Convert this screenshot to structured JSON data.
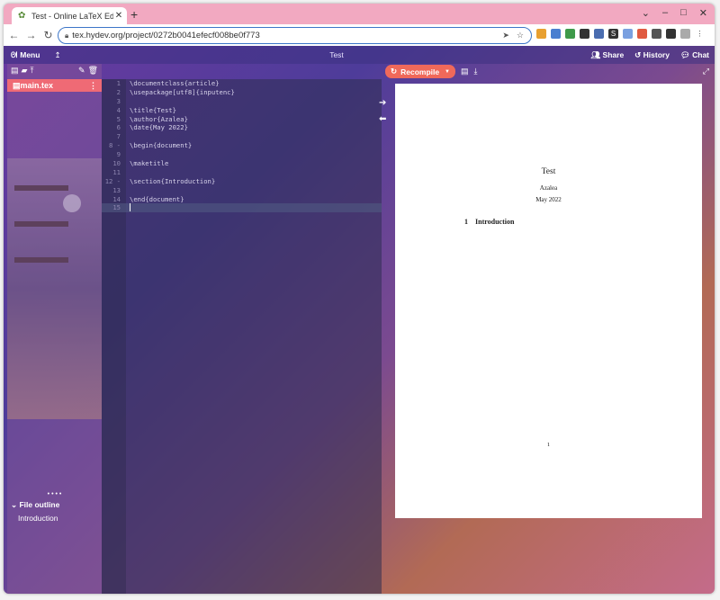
{
  "browser": {
    "tab_title": "Test - Online LaTeX Editor ov...",
    "new_tab": "+",
    "url": "tex.hydev.org/project/0272b0041efecf008be0f773",
    "window_controls": [
      "⌄",
      "–",
      "□",
      "✕"
    ]
  },
  "app": {
    "menu_label": "Menu",
    "project_title": "Test",
    "share_label": "Share",
    "history_label": "History",
    "chat_label": "Chat"
  },
  "filetree": {
    "file_name": "main.tex",
    "outline_header": "File outline",
    "outline_item": "Introduction"
  },
  "editor": {
    "lines": [
      {
        "n": "1",
        "code": "\\documentclass{article}"
      },
      {
        "n": "2",
        "code": "\\usepackage[utf8]{inputenc}"
      },
      {
        "n": "3",
        "code": ""
      },
      {
        "n": "4",
        "code": "\\title{Test}"
      },
      {
        "n": "5",
        "code": "\\author{Azalea}"
      },
      {
        "n": "6",
        "code": "\\date{May 2022}"
      },
      {
        "n": "7",
        "code": ""
      },
      {
        "n": "8 -",
        "code": "\\begin{document}"
      },
      {
        "n": "9",
        "code": ""
      },
      {
        "n": "10",
        "code": "\\maketitle"
      },
      {
        "n": "11",
        "code": ""
      },
      {
        "n": "12 -",
        "code": "\\section{Introduction}"
      },
      {
        "n": "13",
        "code": ""
      },
      {
        "n": "14",
        "code": "\\end{document}"
      },
      {
        "n": "15",
        "code": ""
      }
    ]
  },
  "pdf": {
    "recompile_label": "Recompile",
    "title": "Test",
    "author": "Azalea",
    "date": "May 2022",
    "section_number": "1",
    "section_title": "Introduction",
    "page_number": "1"
  },
  "colors": {
    "recompile": "#f0695a",
    "active_file": "#ef6a75",
    "address_border": "#3c76c8"
  }
}
